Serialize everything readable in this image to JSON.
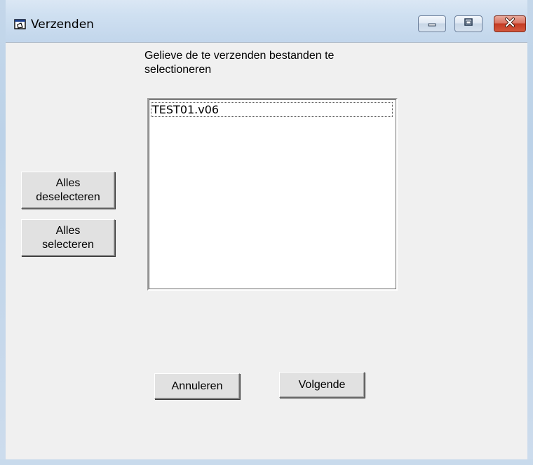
{
  "window": {
    "title": "Verzenden",
    "icon": "form-window-icon",
    "controls": [
      "minimize-icon",
      "maximize-icon",
      "close-icon"
    ]
  },
  "instruction": "Gelieve de te verzenden bestanden te selectioneren",
  "file_list": {
    "items": [
      "TEST01.v06"
    ]
  },
  "buttons": {
    "deselect_all": "Alles deselecteren",
    "select_all": "Alles selecteren",
    "cancel": "Annuleren",
    "next": "Volgende"
  },
  "colors": {
    "close_button": "#c43b23",
    "titlebar": "#cfe0f1"
  }
}
